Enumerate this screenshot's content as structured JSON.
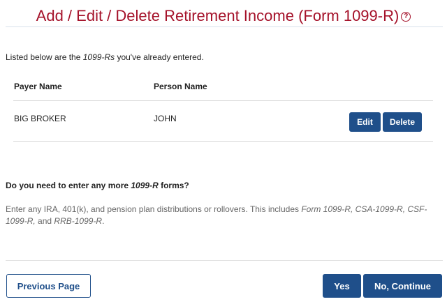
{
  "header": {
    "title": "Add / Edit / Delete Retirement Income (Form 1099-R)",
    "help_icon": "?"
  },
  "intro": {
    "before": "Listed below are the ",
    "em": "1099-Rs",
    "after": " you've already entered."
  },
  "table": {
    "columns": [
      "Payer Name",
      "Person Name"
    ],
    "rows": [
      {
        "payer": "BIG BROKER",
        "person": "JOHN",
        "edit_label": "Edit",
        "delete_label": "Delete"
      }
    ]
  },
  "question": {
    "before": "Do you need to enter any more ",
    "em": "1099-R",
    "after": " forms?"
  },
  "help": {
    "text": "Enter any IRA, 401(k), and pension plan distributions or rollovers. This includes ",
    "forms_em": "Form 1099-R, CSA-1099-R, CSF-1099-R,",
    "and": " and ",
    "last_em": "RRB-1099-R",
    "end": "."
  },
  "footer": {
    "previous_label": "Previous Page",
    "yes_label": "Yes",
    "no_label": "No, Continue"
  },
  "colors": {
    "title": "#a5122a",
    "primary_button": "#1f4f8a",
    "help_text": "#666666"
  },
  "icons": {
    "help": "question-circle-icon"
  }
}
